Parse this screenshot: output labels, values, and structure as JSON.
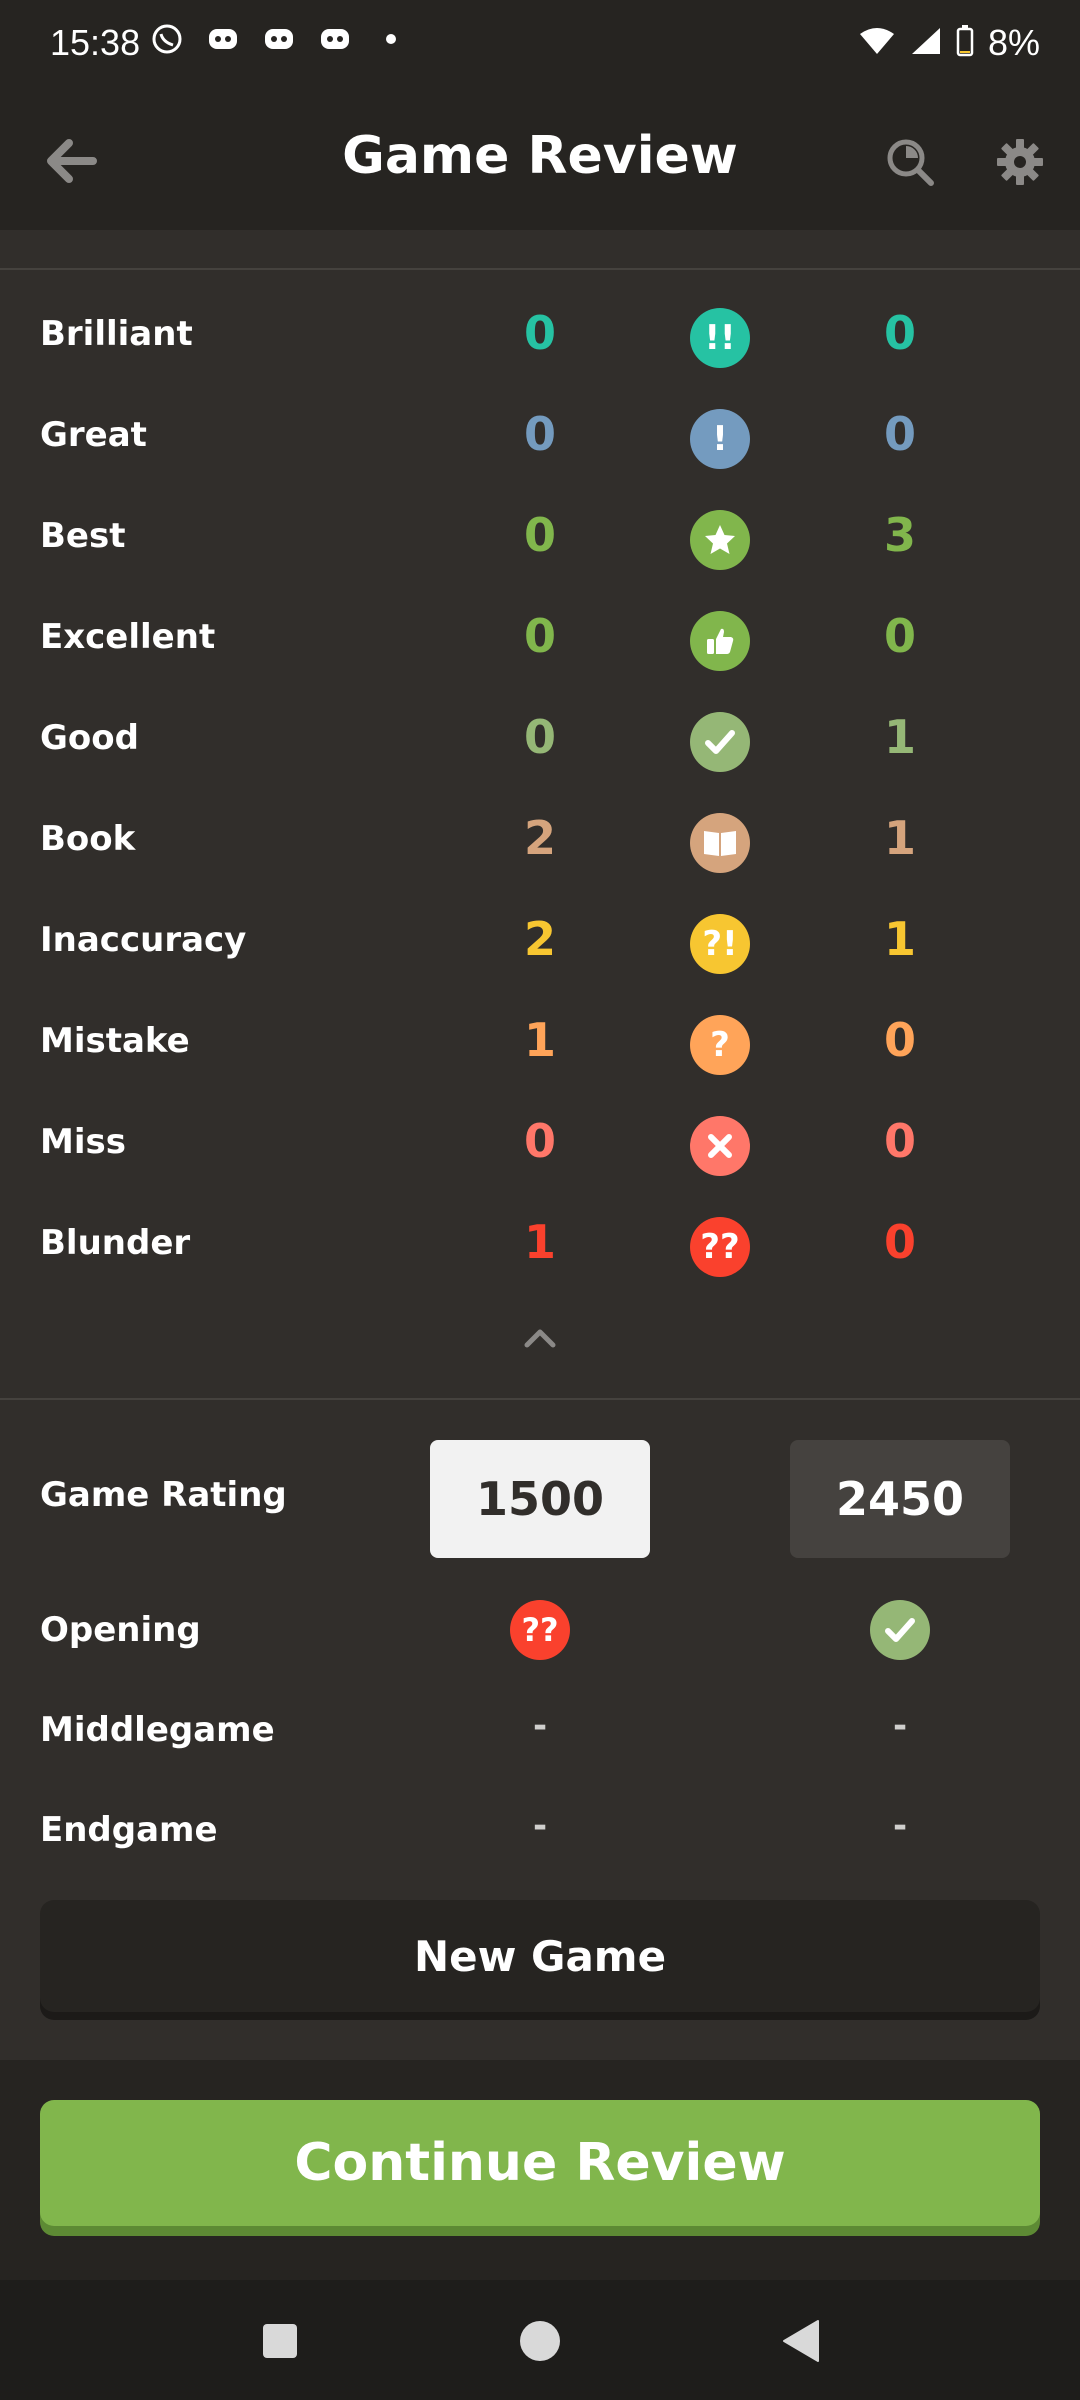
{
  "status_bar": {
    "time": "15:38",
    "battery": "8%"
  },
  "header": {
    "title": "Game Review"
  },
  "colors": {
    "brilliant": "#26c2a3",
    "great": "#749bbf",
    "best": "#81b64c",
    "excellent": "#81b64c",
    "good": "#95b776",
    "book": "#d5a47d",
    "inaccuracy": "#f7c631",
    "mistake": "#ffa459",
    "miss": "#ff7769",
    "blunder": "#fa412d",
    "continue": "#81b64c"
  },
  "move_quality": [
    {
      "label": "Brilliant",
      "left": "0",
      "right": "0",
      "symbol": "!!"
    },
    {
      "label": "Great",
      "left": "0",
      "right": "0",
      "symbol": "!"
    },
    {
      "label": "Best",
      "left": "0",
      "right": "3",
      "symbol": "star"
    },
    {
      "label": "Excellent",
      "left": "0",
      "right": "0",
      "symbol": "thumb"
    },
    {
      "label": "Good",
      "left": "0",
      "right": "1",
      "symbol": "check"
    },
    {
      "label": "Book",
      "left": "2",
      "right": "1",
      "symbol": "book"
    },
    {
      "label": "Inaccuracy",
      "left": "2",
      "right": "1",
      "symbol": "?!"
    },
    {
      "label": "Mistake",
      "left": "1",
      "right": "0",
      "symbol": "?"
    },
    {
      "label": "Miss",
      "left": "0",
      "right": "0",
      "symbol": "x"
    },
    {
      "label": "Blunder",
      "left": "1",
      "right": "0",
      "symbol": "??"
    }
  ],
  "ratings": {
    "label": "Game Rating",
    "left": "1500",
    "right": "2450"
  },
  "phases": {
    "opening": {
      "label": "Opening",
      "left_icon": "blunder",
      "right_icon": "good"
    },
    "middlegame": {
      "label": "Middlegame",
      "left": "-",
      "right": "-"
    },
    "endgame": {
      "label": "Endgame",
      "left": "-",
      "right": "-"
    }
  },
  "buttons": {
    "new_game": "New Game",
    "continue_review": "Continue Review"
  }
}
